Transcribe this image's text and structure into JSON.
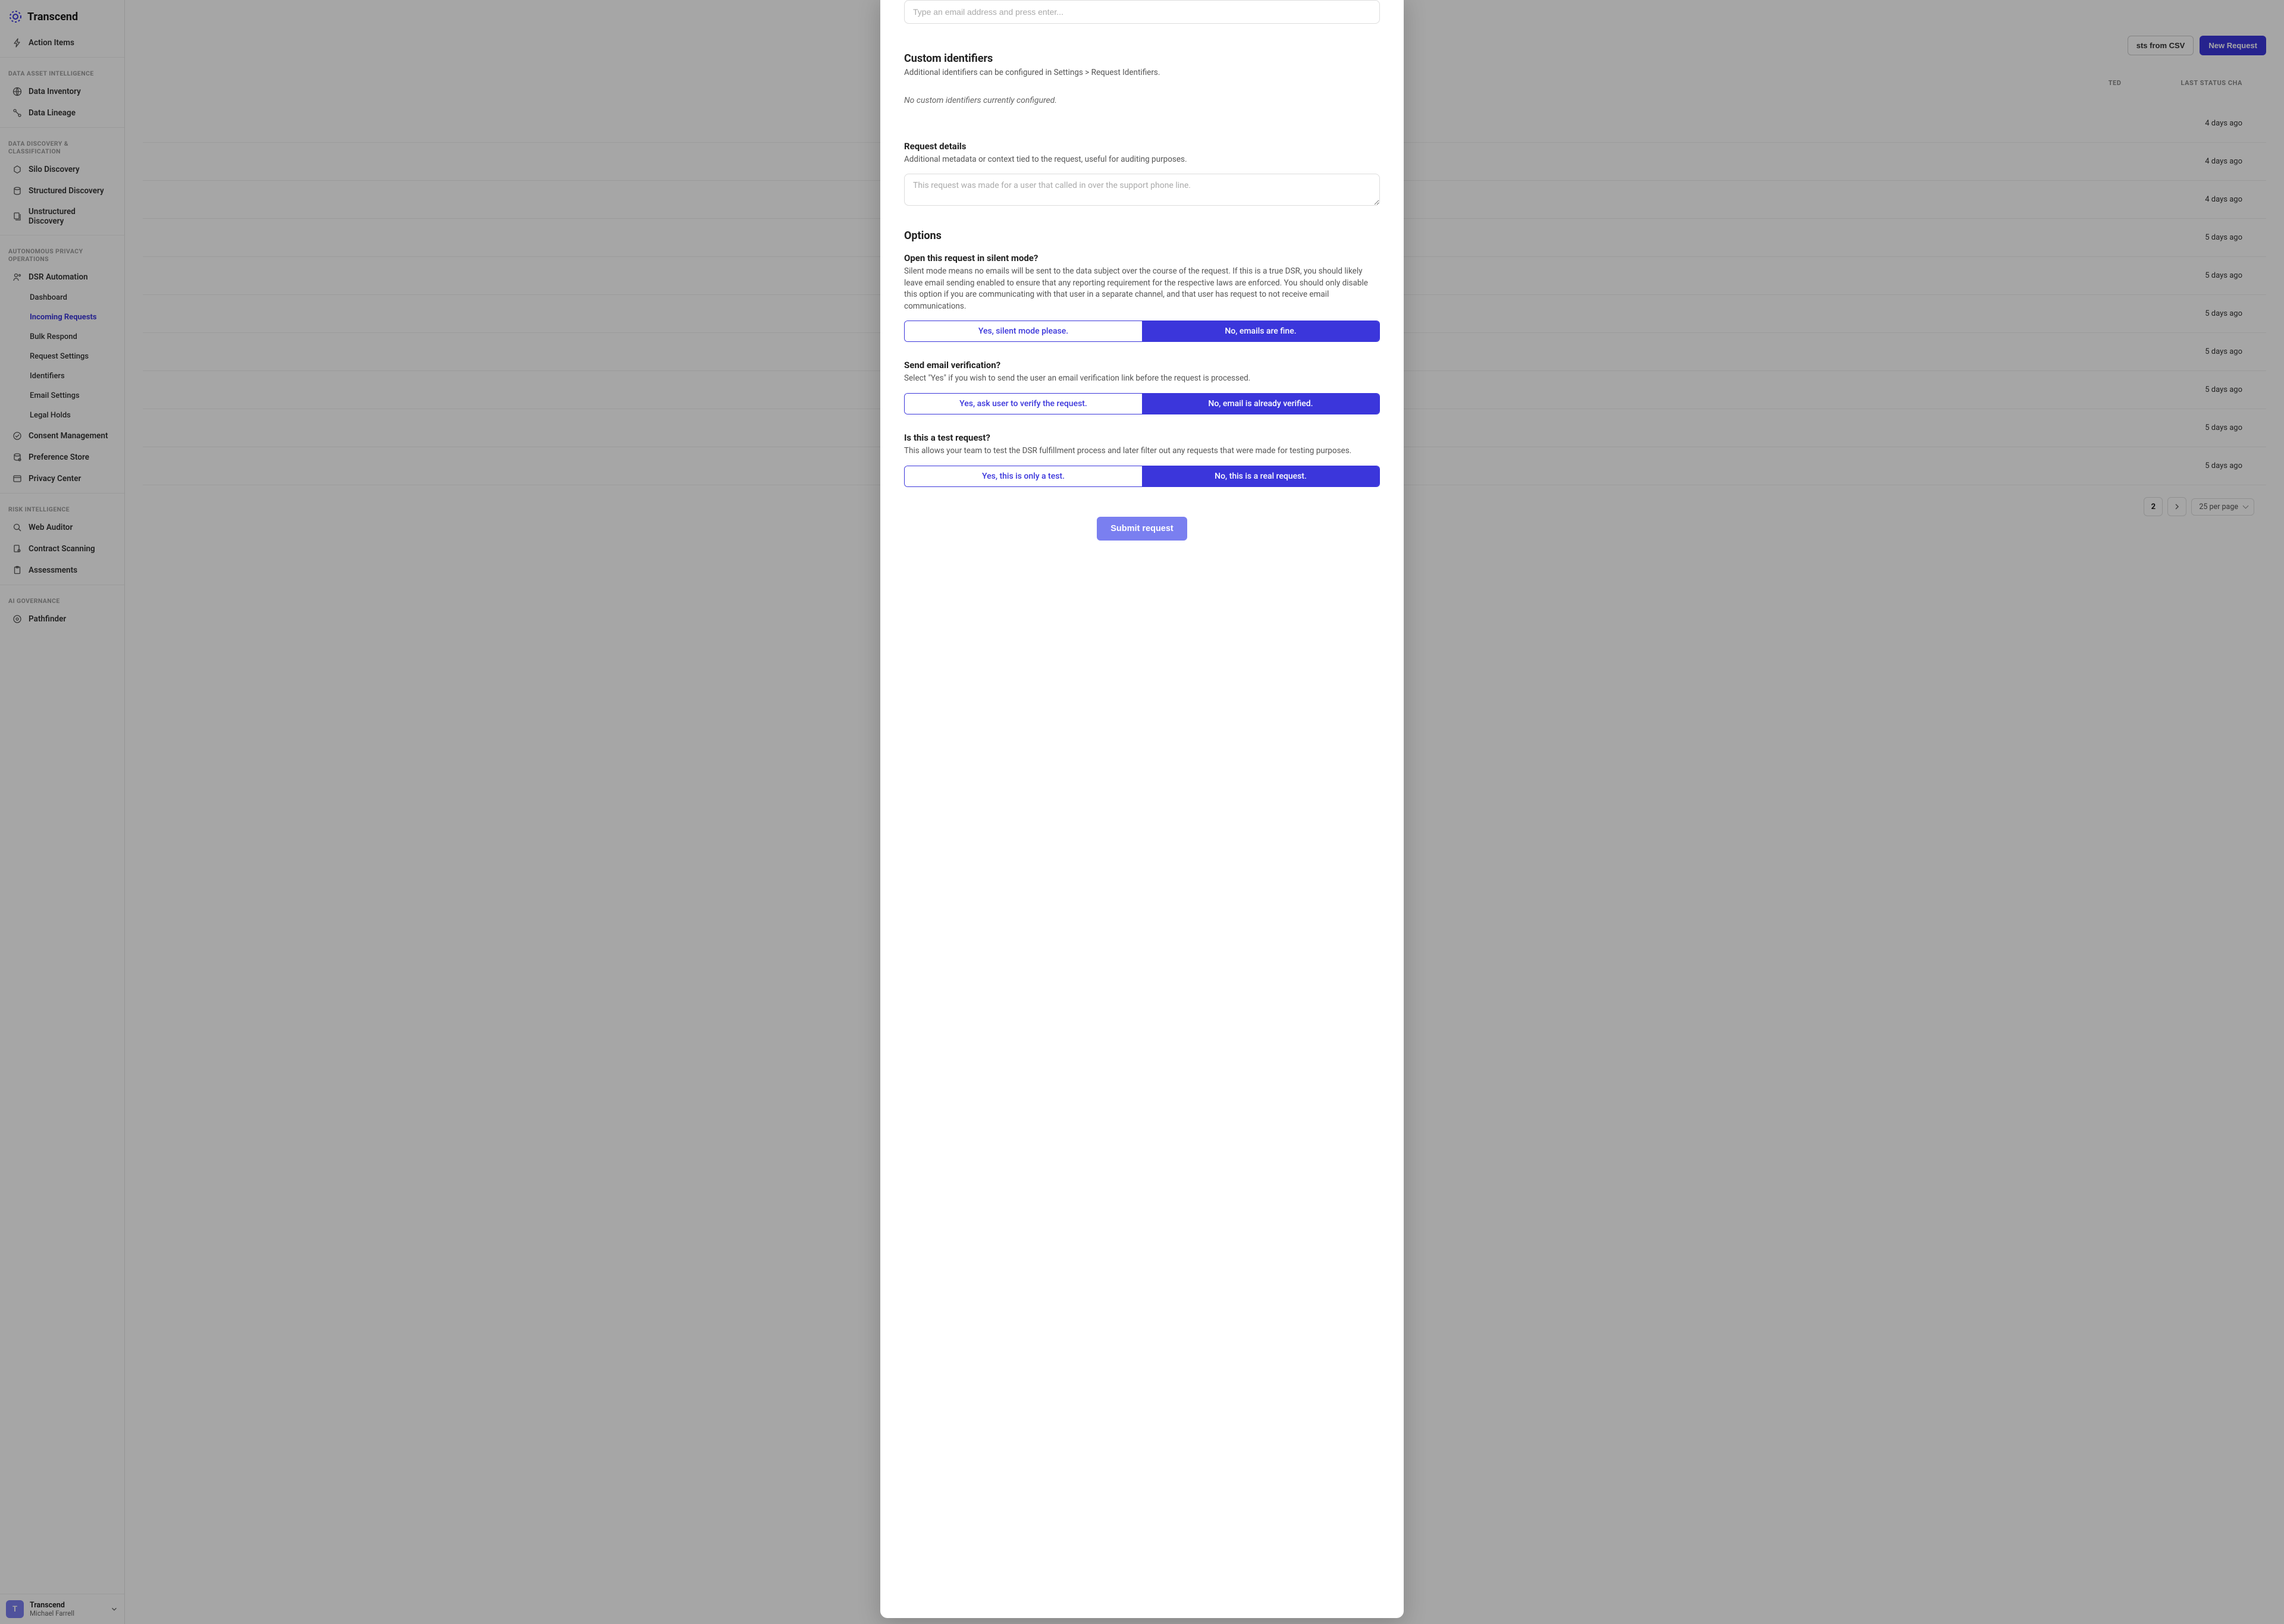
{
  "brand": {
    "name": "Transcend"
  },
  "sidebar": {
    "action_items": "Action Items",
    "section1": "Data Asset Intelligence",
    "data_inventory": "Data Inventory",
    "data_lineage": "Data Lineage",
    "section2": "Data Discovery & Classification",
    "silo_discovery": "Silo Discovery",
    "structured_discovery": "Structured Discovery",
    "unstructured_discovery": "Unstructured Discovery",
    "section3": "Autonomous Privacy Operations",
    "dsr_automation": "DSR Automation",
    "dashboard": "Dashboard",
    "incoming_requests": "Incoming Requests",
    "bulk_respond": "Bulk Respond",
    "request_settings": "Request Settings",
    "identifiers": "Identifiers",
    "email_settings": "Email Settings",
    "legal_holds": "Legal Holds",
    "consent_management": "Consent Management",
    "preference_store": "Preference Store",
    "privacy_center": "Privacy Center",
    "section4": "Risk Intelligence",
    "web_auditor": "Web Auditor",
    "contract_scanning": "Contract Scanning",
    "assessments": "Assessments",
    "section5": "AI Governance",
    "pathfinder": "Pathfinder"
  },
  "footer": {
    "org": "Transcend",
    "user": "Michael Farrell",
    "initial": "T"
  },
  "main": {
    "csv_btn": "sts from CSV",
    "new_request_btn": "New Request",
    "col1": "TED",
    "col2": "LAST STATUS CHA",
    "rows": [
      "4 days ago",
      "4 days ago",
      "4 days ago",
      "5 days ago",
      "5 days ago",
      "5 days ago",
      "5 days ago",
      "5 days ago",
      "5 days ago",
      "5 days ago"
    ],
    "page": "2",
    "per_page": "25 per page"
  },
  "modal": {
    "email_placeholder": "Type an email address and press enter...",
    "custom_h": "Custom identifiers",
    "custom_desc": "Additional identifiers can be configured in Settings > Request Identifiers.",
    "custom_empty": "No custom identifiers currently configured.",
    "details_h": "Request details",
    "details_desc": "Additional metadata or context tied to the request, useful for auditing purposes.",
    "details_placeholder": "This request was made for a user that called in over the support phone line.",
    "options_h": "Options",
    "silent_h": "Open this request in silent mode?",
    "silent_desc": "Silent mode means no emails will be sent to the data subject over the course of the request. If this is a true DSR, you should likely leave email sending enabled to ensure that any reporting requirement for the respective laws are enforced. You should only disable this option if you are communicating with that user in a separate channel, and that user has request to not receive email communications.",
    "silent_yes": "Yes, silent mode please.",
    "silent_no": "No, emails are fine.",
    "verify_h": "Send email verification?",
    "verify_desc": "Select \"Yes\" if you wish to send the user an email verification link before the request is processed.",
    "verify_yes": "Yes, ask user to verify the request.",
    "verify_no": "No, email is already verified.",
    "test_h": "Is this a test request?",
    "test_desc": "This allows your team to test the DSR fulfillment process and later filter out any requests that were made for testing purposes.",
    "test_yes": "Yes, this is only a test.",
    "test_no": "No, this is a real request.",
    "submit": "Submit request"
  }
}
